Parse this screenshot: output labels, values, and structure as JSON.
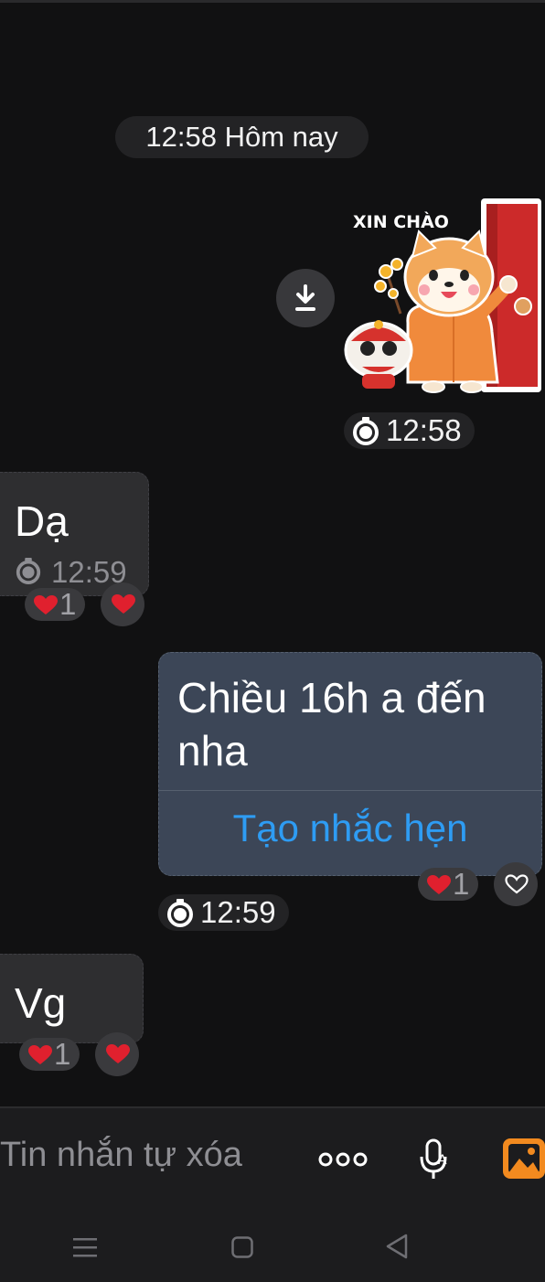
{
  "date_separator": "12:58 Hôm nay",
  "sticker": {
    "text": "XIN CHÀO",
    "time": "12:58"
  },
  "messages": [
    {
      "text": "Dạ",
      "time": "12:59",
      "reaction_count": "1"
    },
    {
      "text": "Chiều 16h a đến nha",
      "action": "Tạo nhắc hẹn",
      "time": "12:59",
      "reaction_count": "1"
    },
    {
      "text": "Vg",
      "reaction_count": "1"
    }
  ],
  "input": {
    "placeholder": "Tin nhắn tự xóa"
  },
  "icons": {
    "download": "download-icon",
    "timer": "timer-icon",
    "heart": "heart-icon",
    "more": "more-dots-icon",
    "mic": "voice-to-text-icon",
    "image": "image-icon",
    "nav_menu": "recent-apps-icon",
    "nav_home": "home-icon",
    "nav_back": "back-icon"
  },
  "colors": {
    "accent": "#2e9cf3",
    "heart": "#e0202e",
    "sticker_orange": "#f08a3c"
  }
}
